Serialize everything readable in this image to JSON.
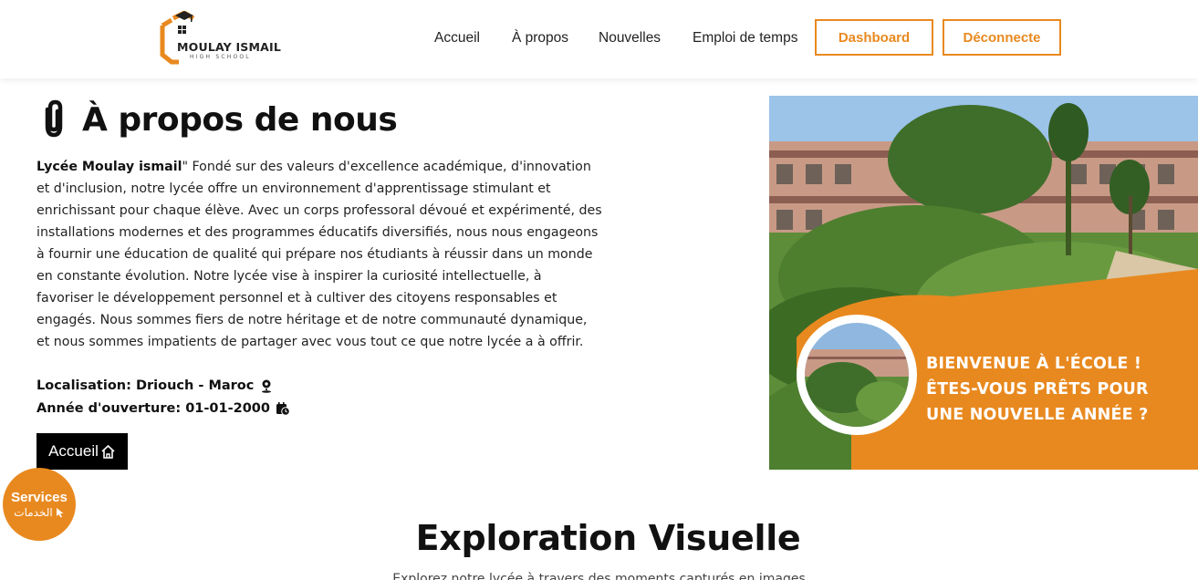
{
  "brand": {
    "name": "MOULAY ISMAIL",
    "subtitle": "HIGH SCHOOL",
    "accent": "#e8891f"
  },
  "nav": {
    "items": [
      "Accueil",
      "À propos",
      "Nouvelles",
      "Emploi de temps"
    ],
    "dashboard_label": "Dashboard",
    "logout_label": "Déconnecte"
  },
  "about": {
    "title": "À propos de nous",
    "title_icon": "paperclip-icon",
    "lead_bold": "Lycée Moulay ismail",
    "body": "\" Fondé sur des valeurs d'excellence académique, d'innovation et d'inclusion, notre lycée offre un environnement d'apprentissage stimulant et enrichissant pour chaque élève. Avec un corps professoral dévoué et expérimenté, des installations modernes et des programmes éducatifs diversifiés, nous nous engageons à fournir une éducation de qualité qui prépare nos étudiants à réussir dans un monde en constante évolution. Notre lycée vise à inspirer la curiosité intellectuelle, à favoriser le développement personnel et à cultiver des citoyens responsables et engagés. Nous sommes fiers de notre héritage et de notre communauté dynamique, et nous sommes impatients de partager avec vous tout ce que notre lycée a à offrir.",
    "location": "Localisation: Driouch - Maroc",
    "location_icon": "map-pin-icon",
    "opening": "Année d'ouverture: 01-01-2000",
    "opening_icon": "calendar-clock-icon",
    "home_button": "Accueil",
    "home_icon": "home-icon"
  },
  "hero": {
    "lines": [
      "BIENVENUE À L'ÉCOLE !",
      "ÊTES-VOUS PRÊTS POUR",
      "UNE NOUVELLE ANNÉE ?"
    ]
  },
  "services": {
    "label": "Services",
    "label_ar": "الخدمات",
    "icon": "pointer-icon"
  },
  "section": {
    "title": "Exploration Visuelle",
    "subtitle": "Explorez notre lycée à travers des moments capturés en images"
  }
}
